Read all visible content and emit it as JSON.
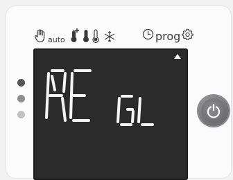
{
  "mode_bar": {
    "auto_label": "auto",
    "prog_label": "prog"
  },
  "display": {
    "main_text": "RE",
    "sub_text": "GL",
    "arrow": "up"
  },
  "indicators": [
    {
      "name": "indicator-1",
      "color": "#555558"
    },
    {
      "name": "indicator-2",
      "color": "#8f8f92"
    },
    {
      "name": "indicator-3",
      "color": "#c2c2c5"
    }
  ],
  "colors": {
    "lcd_background": "#2b2b2c",
    "lcd_segment": "#f4f4f4",
    "power_button": "#7a7a7d"
  }
}
